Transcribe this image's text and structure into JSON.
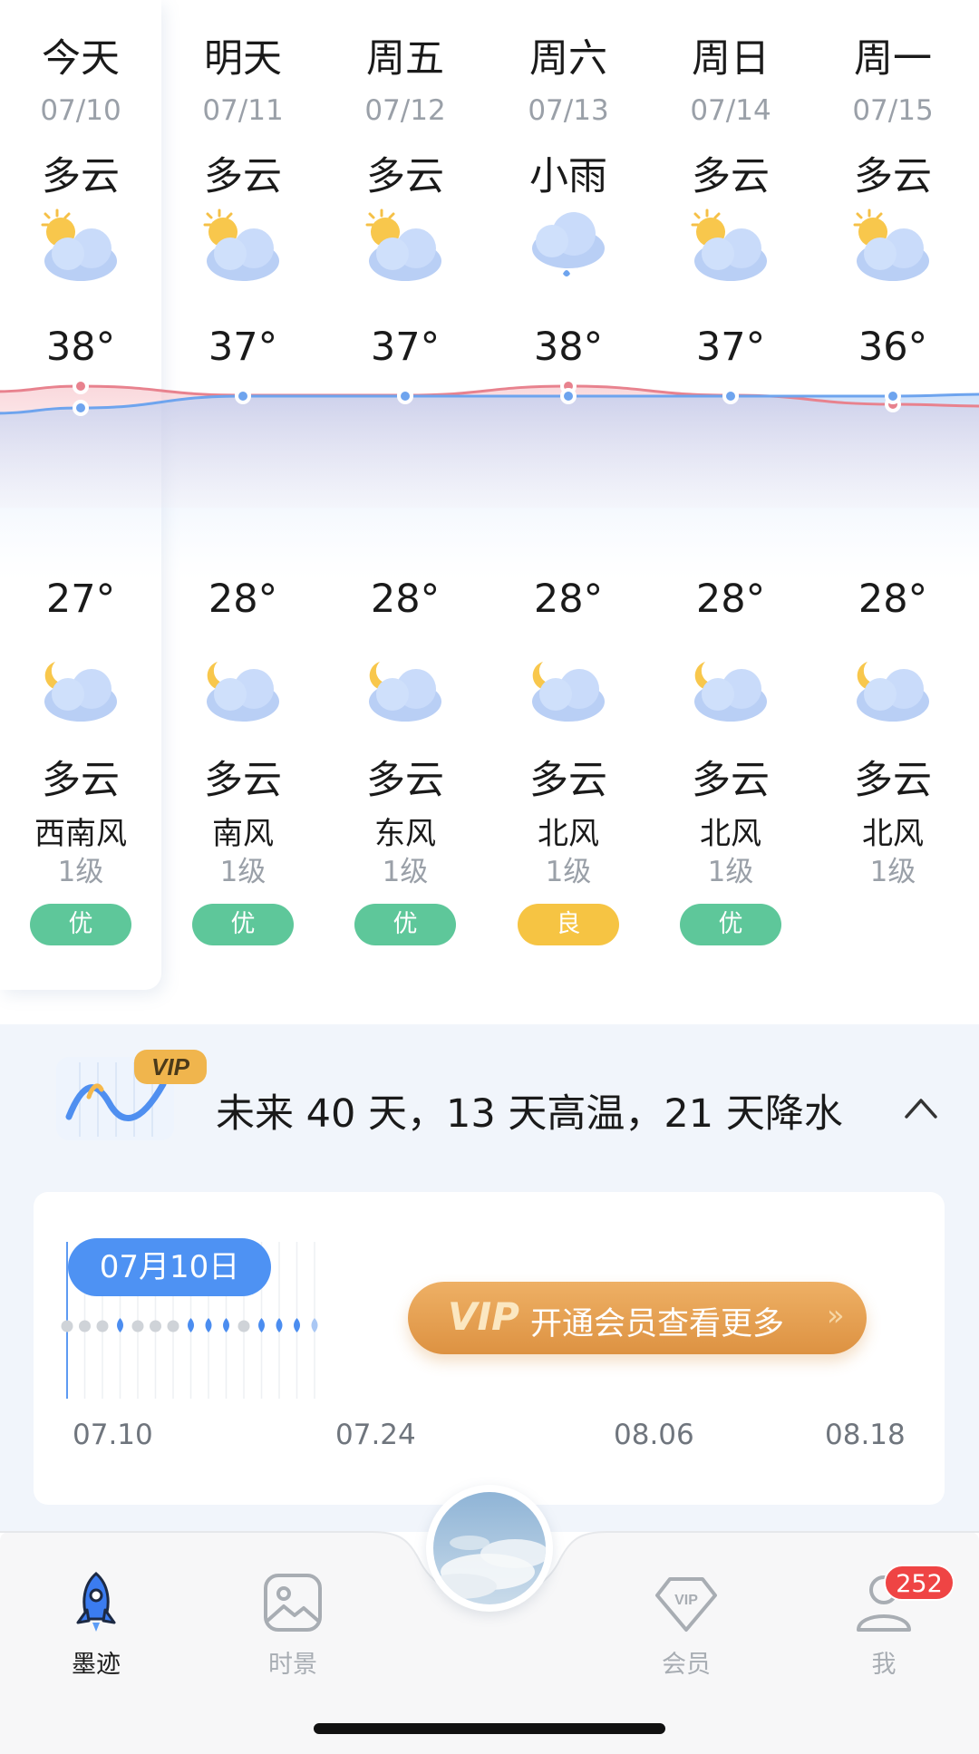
{
  "forecast": {
    "days": [
      {
        "name": "今天",
        "date": "07/10",
        "day_condition": "多云",
        "day_icon": "partly-cloudy-day-icon",
        "high": "38°",
        "low": "27°",
        "night_icon": "partly-cloudy-night-icon",
        "night_condition": "多云",
        "wind_dir": "西南风",
        "wind_level": "1级",
        "aqi": "优",
        "aqi_color": "#5ec79a"
      },
      {
        "name": "明天",
        "date": "07/11",
        "day_condition": "多云",
        "day_icon": "partly-cloudy-day-icon",
        "high": "37°",
        "low": "28°",
        "night_icon": "partly-cloudy-night-icon",
        "night_condition": "多云",
        "wind_dir": "南风",
        "wind_level": "1级",
        "aqi": "优",
        "aqi_color": "#5ec79a"
      },
      {
        "name": "周五",
        "date": "07/12",
        "day_condition": "多云",
        "day_icon": "partly-cloudy-day-icon",
        "high": "37°",
        "low": "28°",
        "night_icon": "partly-cloudy-night-icon",
        "night_condition": "多云",
        "wind_dir": "东风",
        "wind_level": "1级",
        "aqi": "优",
        "aqi_color": "#5ec79a"
      },
      {
        "name": "周六",
        "date": "07/13",
        "day_condition": "小雨",
        "day_icon": "light-rain-icon",
        "high": "38°",
        "low": "28°",
        "night_icon": "partly-cloudy-night-icon",
        "night_condition": "多云",
        "wind_dir": "北风",
        "wind_level": "1级",
        "aqi": "良",
        "aqi_color": "#f6c443"
      },
      {
        "name": "周日",
        "date": "07/14",
        "day_condition": "多云",
        "day_icon": "partly-cloudy-day-icon",
        "high": "37°",
        "low": "28°",
        "night_icon": "partly-cloudy-night-icon",
        "night_condition": "多云",
        "wind_dir": "北风",
        "wind_level": "1级",
        "aqi": "优",
        "aqi_color": "#5ec79a"
      },
      {
        "name": "周一",
        "date": "07/15",
        "day_condition": "多云",
        "day_icon": "partly-cloudy-day-icon",
        "high": "36°",
        "low": "28°",
        "night_icon": "partly-cloudy-night-icon",
        "night_condition": "多云",
        "wind_dir": "北风",
        "wind_level": "1级",
        "aqi": "",
        "aqi_color": ""
      }
    ],
    "high_line_color": "#e8828e",
    "low_line_color": "#6ea4ee"
  },
  "forty_day": {
    "vip_badge": "VIP",
    "summary": "未来 40 天，13 天高温，21 天降水",
    "selected_date": "07月10日",
    "precip_days": [
      "dry",
      "dry",
      "dry",
      "rain",
      "dry",
      "dry",
      "dry",
      "rain",
      "rain",
      "rain",
      "dry",
      "rain",
      "rain",
      "rain",
      "rain"
    ],
    "axis_labels": [
      "07.10",
      "07.24",
      "08.06",
      "08.18"
    ],
    "cta": {
      "vip_mark": "VIP",
      "label": "开通会员查看更多",
      "arrow": "»"
    }
  },
  "tabbar": {
    "tabs": [
      {
        "label": "墨迹",
        "icon": "rocket-icon",
        "active": true
      },
      {
        "label": "时景",
        "icon": "picture-icon",
        "active": false
      },
      {
        "label": "会员",
        "icon": "vip-diamond-icon",
        "active": false
      },
      {
        "label": "我",
        "icon": "user-icon",
        "active": false
      }
    ],
    "badge": "252",
    "center_icon": "sky-photo-icon"
  }
}
